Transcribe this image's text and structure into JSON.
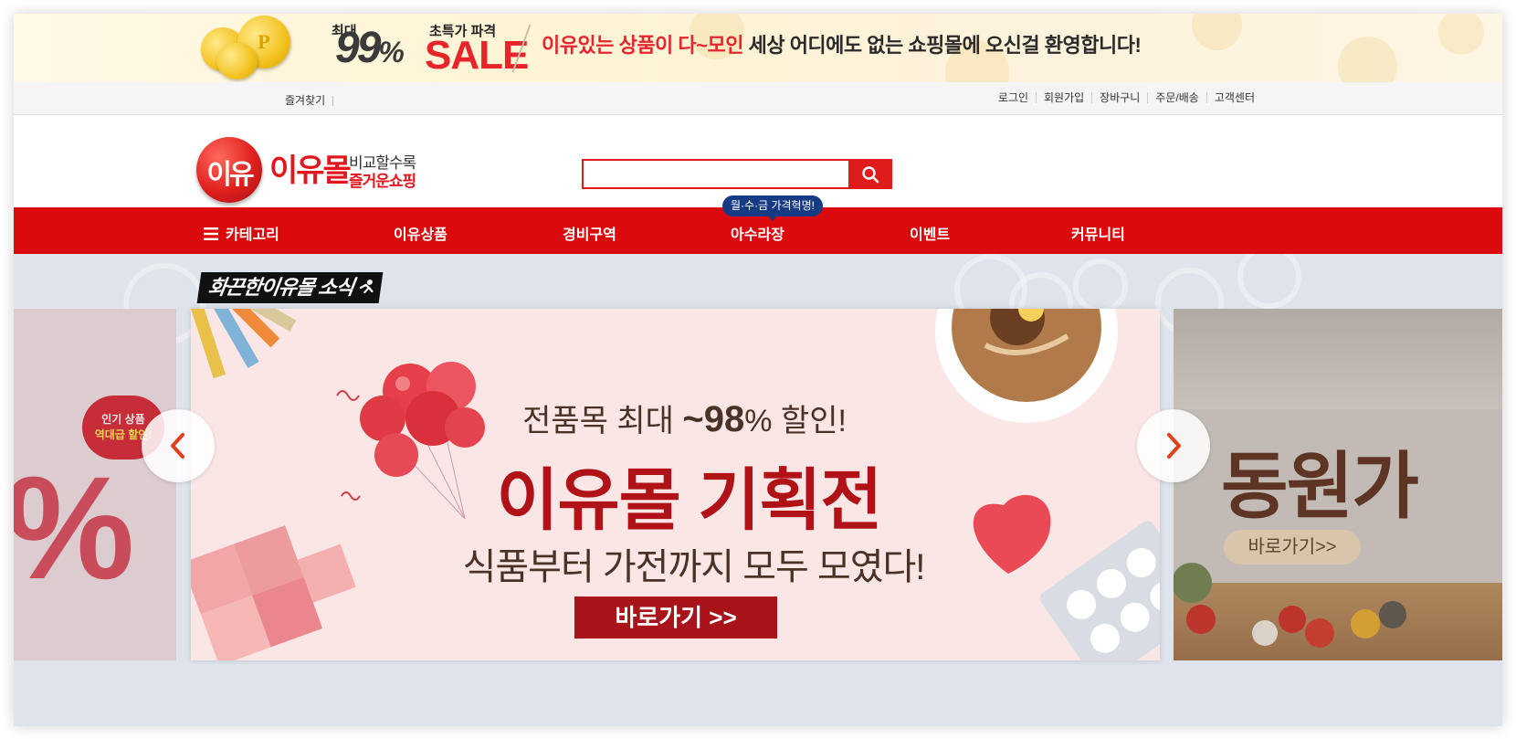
{
  "promo": {
    "max_label": "최대",
    "percent": "99",
    "percent_sign": "%",
    "special_label": "초특가 파격",
    "sale": "SALE",
    "coin_letter": "P",
    "message_red": "이유있는 상품이 다~모인",
    "message_dark": " 세상 어디에도 없는 쇼핑몰에 오신걸 환영합니다!"
  },
  "util": {
    "bookmark": "즐겨찾기",
    "links": [
      "로그인",
      "회원가입",
      "장바구니",
      "주문/배송",
      "고객센터"
    ]
  },
  "header": {
    "logo_ball_text": "이유",
    "logo_name": "이유몰",
    "logo_sub1": "비교할수록",
    "logo_sub2": "즐거운쇼핑",
    "search_value": "",
    "search_placeholder": ""
  },
  "nav": {
    "items": [
      "카테고리",
      "이유상품",
      "경비구역",
      "아수라장",
      "이벤트",
      "커뮤니티"
    ],
    "tip": "월·수·금 가격혁명!"
  },
  "news": {
    "title": "화끈한이유몰 소식"
  },
  "slides": {
    "prev": {
      "bubble_line1": "인기 상품",
      "bubble_line2": "역대급 할인!",
      "big": "%"
    },
    "main": {
      "sub1_prefix": "전품목 최대 ",
      "sub1_value": "~98",
      "sub1_suffix": "% 할인!",
      "headline": "이유몰 기획전",
      "sub2": "식품부터 가전까지 모두 모였다!",
      "cta": "바로가기 >>"
    },
    "next": {
      "big": "동원가",
      "cta": "바로가기>>"
    }
  },
  "colors": {
    "brand_red": "#db0a0c",
    "tip_navy": "#163a84",
    "banner_red": "#a8141a"
  }
}
